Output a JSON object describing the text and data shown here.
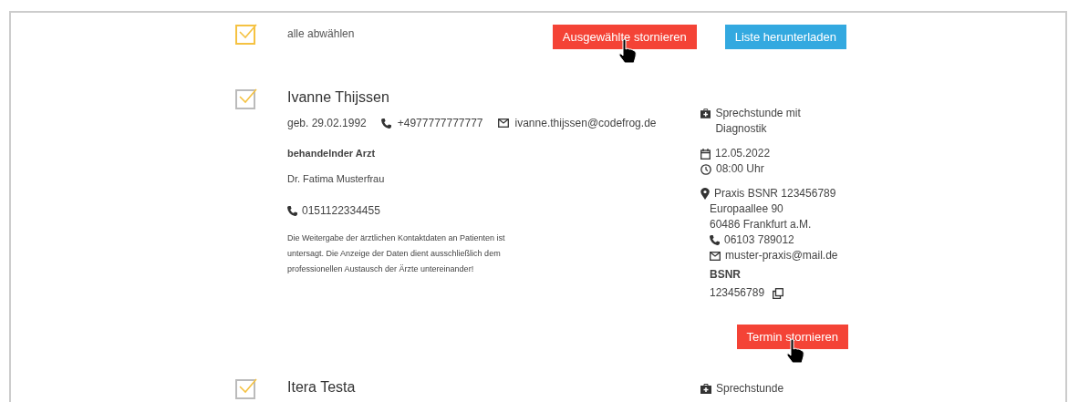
{
  "toolbar": {
    "select_all": {
      "label": "alle abwählen",
      "checked": true
    },
    "buttons": [
      {
        "label": "Ausgewählte stornieren",
        "kind": "danger",
        "hovered": true
      },
      {
        "label": "Liste herunterladen",
        "kind": "info",
        "hovered": false
      }
    ]
  },
  "appointments": [
    {
      "checked": true,
      "name": "Ivanne Thijssen",
      "birth": "geb. 29.02.1992",
      "phone": "+4977777777777",
      "email": "ivanne.thijssen@codefrog.de",
      "doctor_heading": "behandelnder Arzt",
      "doctor": "Dr. Fatima Musterfrau",
      "doctor_phone": "0151122334455",
      "notice": "Die Weitergabe der ärztlichen Kontaktdaten an Patienten ist untersagt. Die Anzeige der Daten dient ausschließlich dem professionellen Austausch der Ärzte untereinander!",
      "type": "Sprechstunde mit Diagnostik",
      "date": "12.05.2022",
      "time": "08:00 Uhr",
      "practice": "Praxis BSNR 123456789",
      "street": "Europaallee 90",
      "city": "60486 Frankfurt a.M.",
      "practice_phone": "06103 789012",
      "practice_email": "muster-praxis@mail.de",
      "bsnr_label": "BSNR",
      "bsnr": "123456789",
      "cancel": {
        "label": "Termin stornieren",
        "hovered": true
      }
    },
    {
      "checked": true,
      "name": "Itera Testa",
      "type": "Sprechstunde"
    }
  ]
}
